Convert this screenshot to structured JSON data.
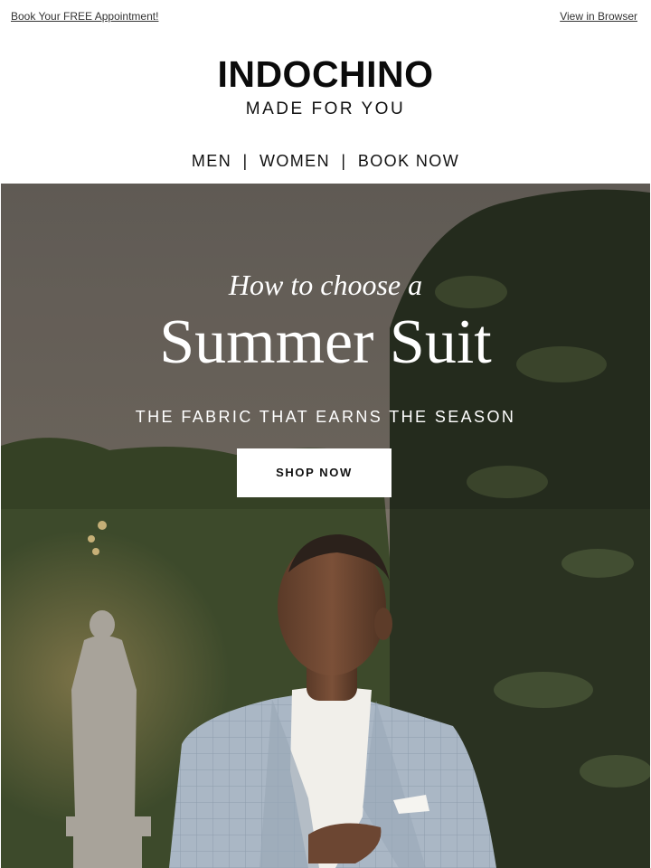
{
  "topbar": {
    "appointment_link": "Book Your FREE Appointment!",
    "browser_link": "View in Browser"
  },
  "brand": {
    "logo": "INDOCHINO",
    "tagline": "MADE FOR YOU"
  },
  "nav": {
    "items": [
      "MEN",
      "WOMEN",
      "BOOK NOW"
    ],
    "separator": "|"
  },
  "hero": {
    "kicker": "How to choose a",
    "headline": "Summer Suit",
    "subheadline": "THE FABRIC THAT EARNS THE SEASON",
    "cta_label": "SHOP NOW"
  },
  "colors": {
    "text": "#111111",
    "background": "#ffffff",
    "hero_text": "#ffffff",
    "suit": "#a9b6c4",
    "hedge": "#3f4a2c"
  }
}
